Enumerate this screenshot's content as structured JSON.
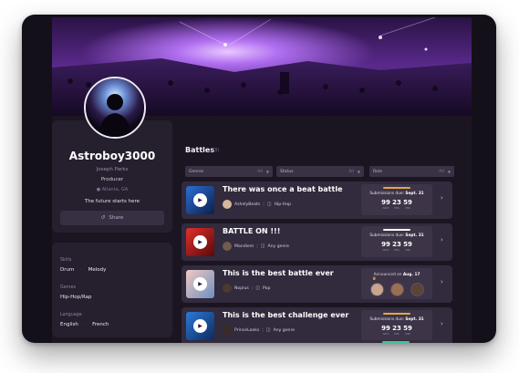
{
  "profile": {
    "username": "Astroboy3000",
    "real_name": "Joseph Parks",
    "role": "Producer",
    "location": "Atlanta, GA",
    "tagline": "The future starts here",
    "share_label": "Share"
  },
  "skills": {
    "label": "Skills",
    "values": [
      "Drum",
      "Melody"
    ],
    "genres_label": "Genres",
    "genres_value": "Hip-Hop/Rap",
    "language_label": "Language",
    "languages": [
      "English",
      "French"
    ]
  },
  "battles": {
    "title": "Battles",
    "count": "(3)",
    "filters": [
      {
        "label": "Genres",
        "count": "All"
      },
      {
        "label": "Status",
        "count": "All"
      },
      {
        "label": "Role",
        "count": "All"
      }
    ],
    "items": [
      {
        "title": "There was once a beat battle",
        "host": "AshelyBeats",
        "genre": "Hip-Hop",
        "due_prefix": "Submissions due:",
        "due_date": "Sept. 31",
        "days": "99",
        "hours": "23",
        "minutes": "59",
        "units": [
          "DAYS",
          "HRS",
          "MIN"
        ],
        "bar_color": "#e3a64b"
      },
      {
        "title": "BATTLE ON !!!",
        "host": "Mandiem",
        "genre": "Any genre",
        "due_prefix": "Submissions due:",
        "due_date": "Sept. 31",
        "days": "99",
        "hours": "23",
        "minutes": "59",
        "units": [
          "DAYS",
          "HRS",
          "MIN"
        ],
        "bar_color": "#ffffff"
      },
      {
        "title": "This is the best battle ever",
        "host": "Noplus",
        "genre": "Pop",
        "announced_prefix": "Announced on",
        "announced_date": "Aug. 17"
      },
      {
        "title": "This is the best challenge ever",
        "host": "PrinceLooks",
        "genre": "Any genre",
        "due_prefix": "Submissions due:",
        "due_date": "Sept. 31",
        "days": "99",
        "hours": "23",
        "minutes": "59",
        "units": [
          "DAYS",
          "HRS",
          "MIN"
        ],
        "bar_color": "#e3a64b"
      }
    ]
  },
  "icons": {
    "share": "share-icon",
    "location": "pin-icon",
    "play": "play-icon",
    "genre": "doc-icon",
    "chevron": "chevron-right-icon",
    "crown": "crown-icon"
  },
  "colors": {
    "background": "#1b1522",
    "panel": "#261f2e",
    "card": "#322a3d",
    "accent_purple": "#8a4fd8"
  }
}
